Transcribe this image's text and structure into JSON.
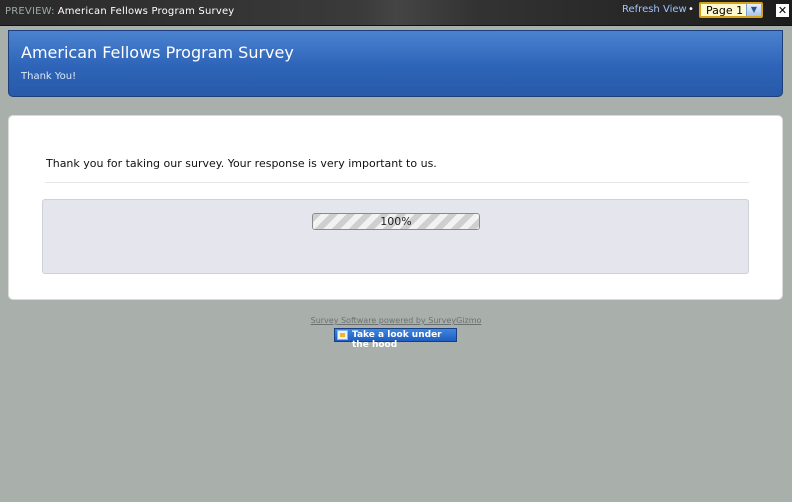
{
  "topbar": {
    "preview_label": "PREVIEW:",
    "preview_title": "American Fellows Program Survey",
    "refresh_label": "Refresh View",
    "separator": "•",
    "page_select_value": "Page 1",
    "close_glyph": "✕"
  },
  "header": {
    "title": "American Fellows Program Survey",
    "subtitle": "Thank You!"
  },
  "main": {
    "thank_you_message": "Thank you for taking our survey. Your response is very important to us.",
    "progress": {
      "value": 1.0,
      "label": "100%"
    }
  },
  "footer": {
    "powered_by": "Survey Software powered by SurveyGizmo",
    "hood_button_label": "Take a look under the hood"
  },
  "colors": {
    "page_background": "#a9b0ac",
    "header_blue": "#2e64b8",
    "page_select_border": "#d6a21d"
  }
}
